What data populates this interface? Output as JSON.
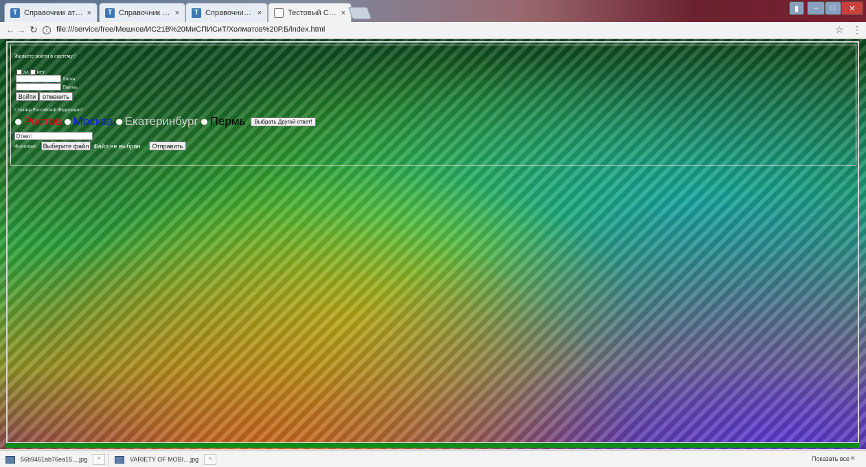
{
  "tabs": [
    {
      "title": "Справочник атрибутов",
      "icon": "site-favicon"
    },
    {
      "title": "Справочник CSS: font-v",
      "icon": "site-favicon"
    },
    {
      "title": "Справочник CSS: font-",
      "icon": "site-favicon"
    },
    {
      "title": "Тестовый Сайт",
      "icon": "document-icon",
      "active": true
    }
  ],
  "tab_close": "×",
  "address_bar": {
    "url": "file:///service/free/Мешков/ИС21В%20МиСПИСиТ/Холматов%20Р.Б/index.html"
  },
  "page": {
    "login_question": "Желаете войти в систему?",
    "yes_label": "да",
    "no_label": "нет",
    "login_label": "Логин",
    "password_label": "Пароль",
    "enter_button": "Войти",
    "cancel_button": "отменить",
    "capital_question": "Столица Российской Федерации?",
    "options": [
      "Ростов",
      "Москва",
      "Екатеринбург",
      "Пермь"
    ],
    "other_answer_button": "Выбрать Другой ответ!",
    "answer_value": "Ответ:",
    "photo_label": "Фотоответ:",
    "choose_file_button": "Выберите файл",
    "no_file_text": "Файл не выбран",
    "submit_button": "Отправить",
    "option_colors": {
      "Ростов": "#e01010",
      "Москва": "#1020d0",
      "Екатеринбург": "#cfcfcf",
      "Пермь": "#000000"
    }
  },
  "downloads": {
    "items": [
      {
        "name": "56b9461ab76ea15....jpg"
      },
      {
        "name": "VARIETY OF MOBI....jpg"
      }
    ],
    "show_all": "Показать все",
    "close": "×"
  }
}
